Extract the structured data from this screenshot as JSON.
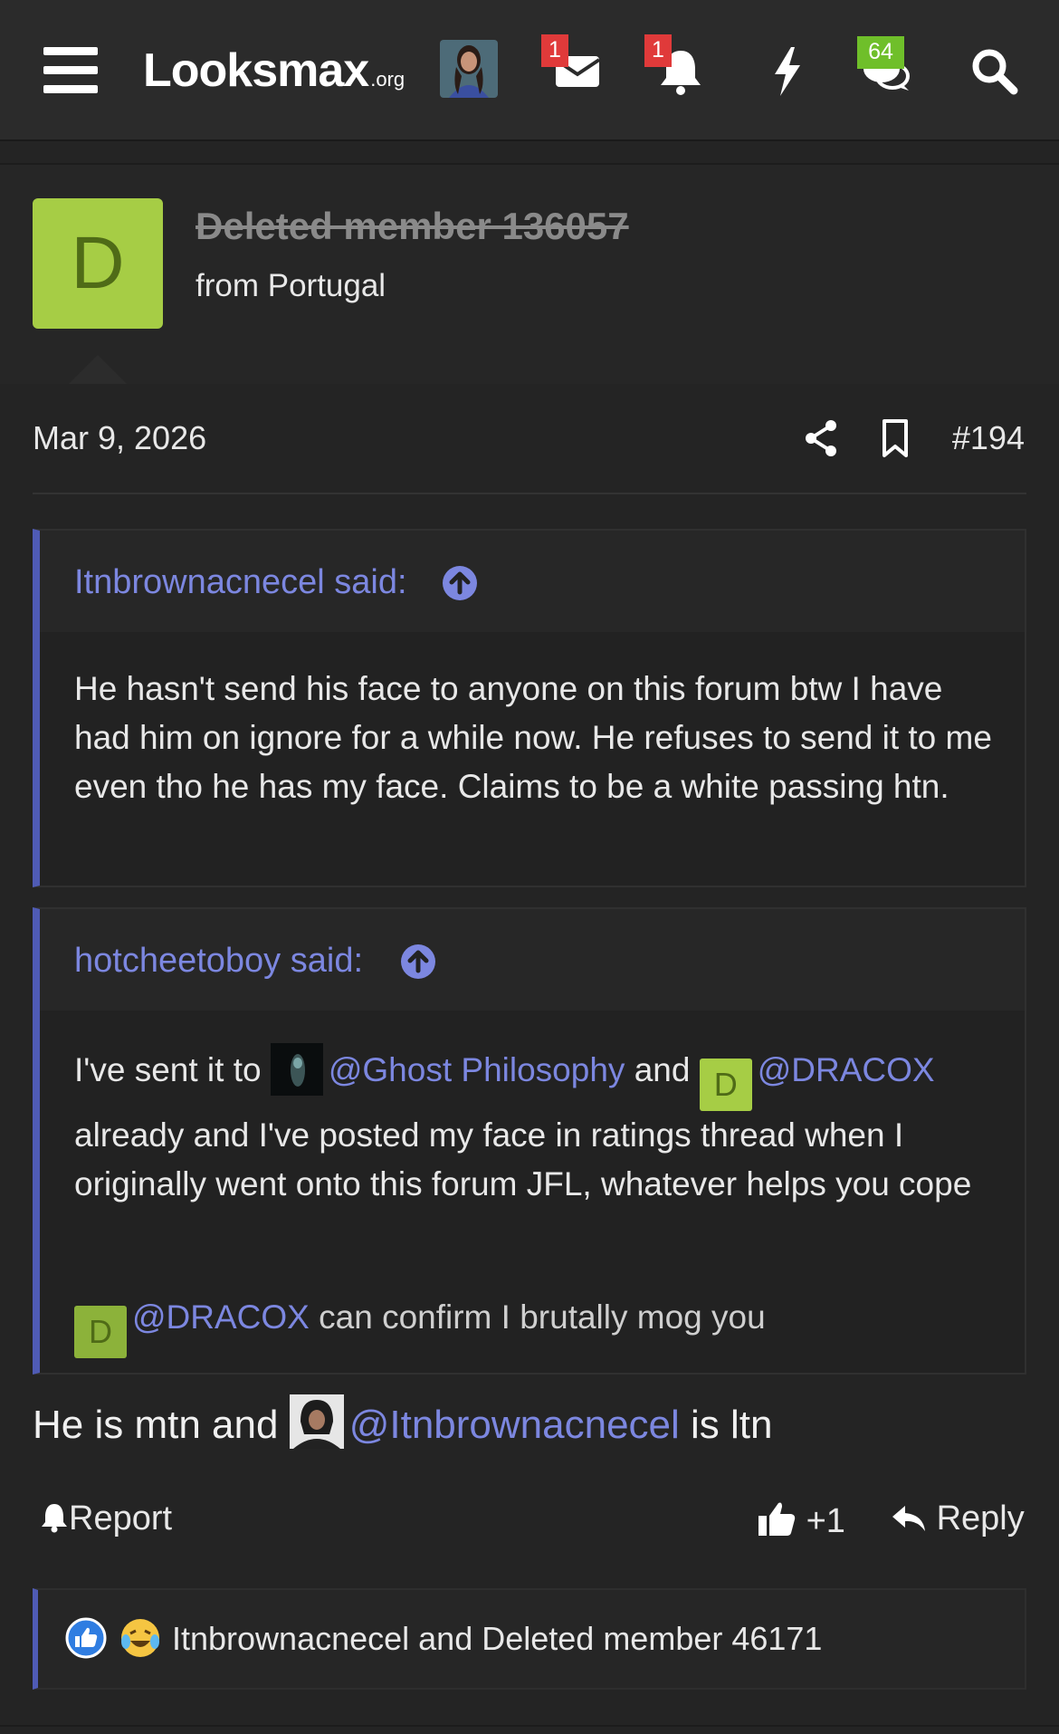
{
  "header": {
    "logo_main": "Looksmax",
    "logo_suffix": ".org",
    "messages_count": "1",
    "alerts_count": "1",
    "chat_count": "64"
  },
  "post": {
    "author": "Deleted member 136057",
    "avatar_letter": "D",
    "location": "from Portugal",
    "date": "Mar 9, 2026",
    "number": "#194"
  },
  "quotes": [
    {
      "author": "Itnbrownacnecel said:",
      "text": "He hasn't send his face to anyone on this forum btw I have had him on ignore for a while now. He refuses to send it to me even tho he has my face. Claims to be a white passing htn."
    },
    {
      "author": "hotcheetoboy said:",
      "line1_prefix": "I've sent it to",
      "mention1": "@Ghost Philosophy",
      "and": "and",
      "mention2": "@DRACOX",
      "avatar_letter": "D",
      "line1_rest": "already and I've posted my face in ratings thread when I originally went onto this forum JFL, whatever helps you cope",
      "mention3": "@DRACOX",
      "line2_rest": "can confirm I brutally mog you"
    }
  ],
  "reply": {
    "prefix": "He is mtn and",
    "mention": "@Itnbrownacnecel",
    "suffix": "is ltn"
  },
  "actions": {
    "report": "Report",
    "like_count": "+1",
    "reply": "Reply"
  },
  "reactions": {
    "text": "Itnbrownacnecel and Deleted member 46171"
  },
  "colors": {
    "accent": "#7c87e0",
    "quote_bar": "#4f5bb5",
    "avatar_bg": "#a6cd45",
    "badge_red": "#e03a3a",
    "badge_green": "#6fbf2a"
  }
}
